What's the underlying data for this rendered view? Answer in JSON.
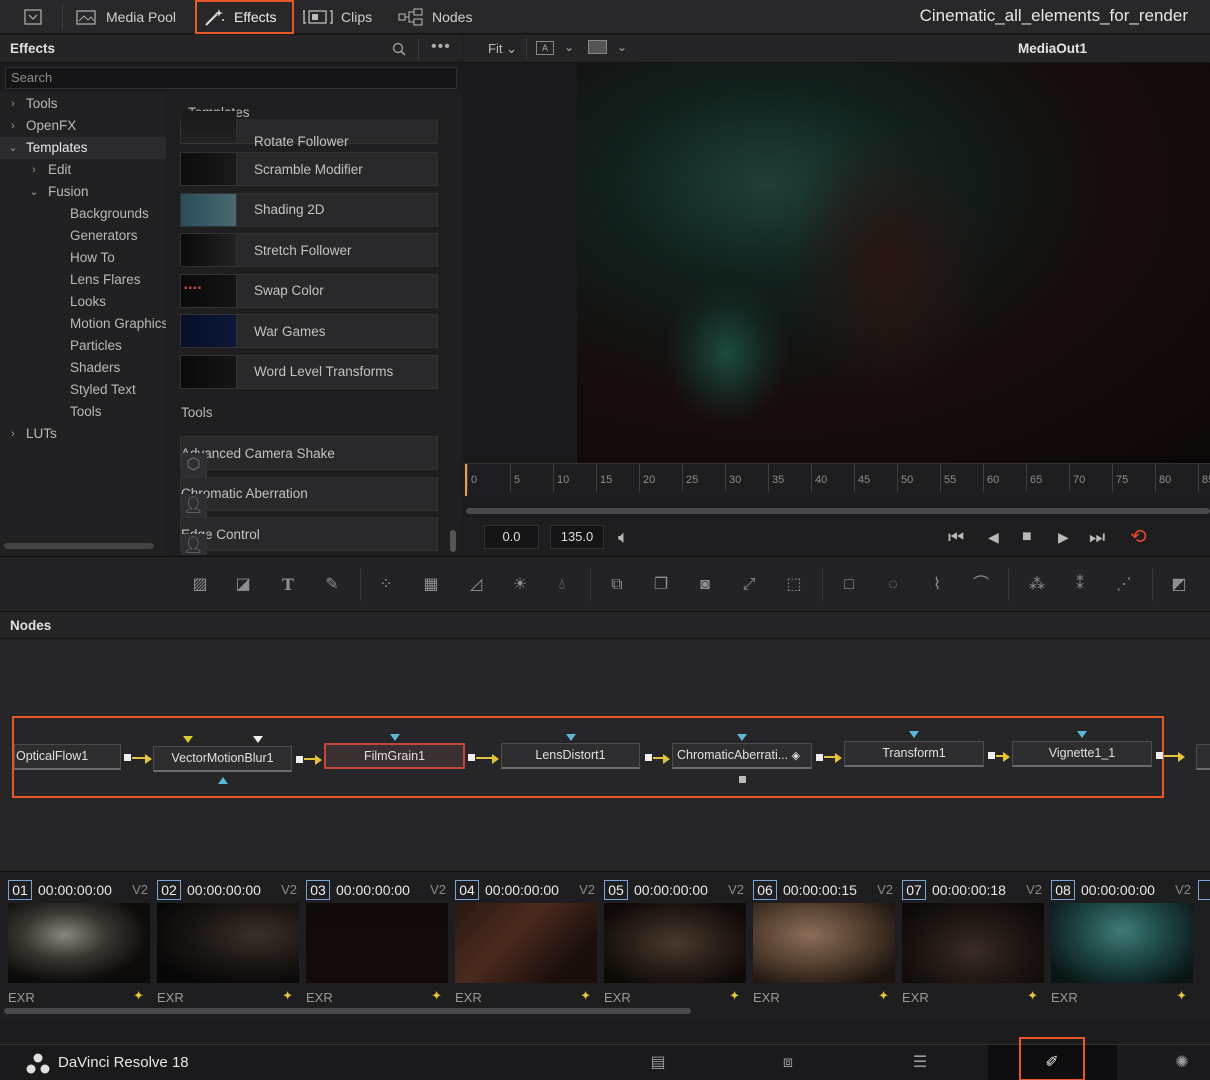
{
  "app": {
    "name": "DaVinci Resolve 18",
    "project_title": "Cinematic_all_elements_for_render"
  },
  "topbar": {
    "tabs": [
      {
        "label": "Media Pool",
        "icon": "media-pool-icon"
      },
      {
        "label": "Effects",
        "icon": "effects-wand-icon",
        "active": true
      },
      {
        "label": "Clips",
        "icon": "clips-icon"
      },
      {
        "label": "Nodes",
        "icon": "nodes-icon"
      }
    ]
  },
  "effects_panel": {
    "title": "Effects",
    "search_placeholder": "Search",
    "tree": [
      {
        "label": "Tools",
        "level": 0,
        "chevron": "›"
      },
      {
        "label": "OpenFX",
        "level": 0,
        "chevron": "›"
      },
      {
        "label": "Templates",
        "level": 0,
        "chevron": "⌄",
        "selected": true
      },
      {
        "label": "Edit",
        "level": 1,
        "chevron": "›"
      },
      {
        "label": "Fusion",
        "level": 1,
        "chevron": "⌄"
      },
      {
        "label": "Backgrounds",
        "level": 2
      },
      {
        "label": "Generators",
        "level": 2
      },
      {
        "label": "How To",
        "level": 2
      },
      {
        "label": "Lens Flares",
        "level": 2
      },
      {
        "label": "Looks",
        "level": 2
      },
      {
        "label": "Motion Graphics",
        "level": 2
      },
      {
        "label": "Particles",
        "level": 2
      },
      {
        "label": "Shaders",
        "level": 2
      },
      {
        "label": "Styled Text",
        "level": 2
      },
      {
        "label": "Tools",
        "level": 2
      },
      {
        "label": "LUTs",
        "level": 0,
        "chevron": "›"
      }
    ],
    "templates_group": "Templates",
    "templates": [
      "Rotate Follower",
      "Scramble Modifier",
      "Shading 2D",
      "Stretch Follower",
      "Swap Color",
      "War Games",
      "Word Level Transforms"
    ],
    "tools_group": "Tools",
    "tools": [
      "Advanced Camera Shake",
      "Chromatic Aberration",
      "Edge Control"
    ]
  },
  "viewer": {
    "zoom": "Fit",
    "output_name": "MediaOut1",
    "ruler_ticks": [
      "0",
      "5",
      "10",
      "15",
      "20",
      "25",
      "30",
      "35",
      "40",
      "45",
      "50",
      "55",
      "60",
      "65",
      "70",
      "75",
      "80",
      "85"
    ],
    "current_time": "0.0",
    "end_time": "135.0"
  },
  "nodes_panel": {
    "title": "Nodes",
    "nodes": [
      "OpticalFlow1",
      "VectorMotionBlur1",
      "FilmGrain1",
      "LensDistort1",
      "ChromaticAberrati...",
      "Transform1",
      "Vignette1_1"
    ],
    "active_node": "FilmGrain1"
  },
  "clips": [
    {
      "num": "01",
      "tc": "00:00:00:00",
      "track": "V2",
      "format": "EXR"
    },
    {
      "num": "02",
      "tc": "00:00:00:00",
      "track": "V2",
      "format": "EXR"
    },
    {
      "num": "03",
      "tc": "00:00:00:00",
      "track": "V2",
      "format": "EXR"
    },
    {
      "num": "04",
      "tc": "00:00:00:00",
      "track": "V2",
      "format": "EXR"
    },
    {
      "num": "05",
      "tc": "00:00:00:00",
      "track": "V2",
      "format": "EXR"
    },
    {
      "num": "06",
      "tc": "00:00:00:15",
      "track": "V2",
      "format": "EXR"
    },
    {
      "num": "07",
      "tc": "00:00:00:18",
      "track": "V2",
      "format": "EXR"
    },
    {
      "num": "08",
      "tc": "00:00:00:00",
      "track": "V2",
      "format": "EXR"
    }
  ],
  "colors": {
    "highlight": "#e8572a",
    "connection": "#e4c43c",
    "input_arrow": "#5bb8d6",
    "clip_number_border": "#7aa5d6"
  }
}
